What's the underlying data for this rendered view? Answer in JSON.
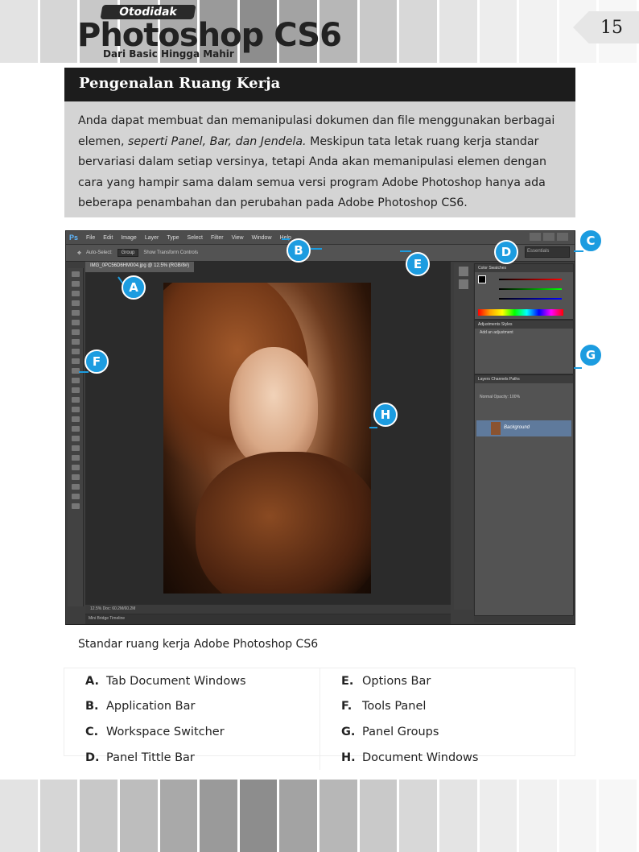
{
  "header": {
    "logo_small": "Otodidak",
    "logo_big": "Photoshop CS6",
    "logo_sub": "Dari Basic Hingga Mahir",
    "page_number": "15",
    "stripe_colors": [
      "#e3e3e3",
      "#d6d6d6",
      "#c8c8c8",
      "#bdbdbd",
      "#a9a9a9",
      "#9a9a9a",
      "#8d8d8d",
      "#a3a3a3",
      "#b7b7b7",
      "#c9c9c9",
      "#d8d8d8",
      "#e4e4e4",
      "#ededed",
      "#f2f2f2",
      "#f5f5f5",
      "#f7f7f7"
    ]
  },
  "section": {
    "title": "Pengenalan Ruang Kerja",
    "intro_before_italic": "Anda dapat membuat dan memanipulasi dokumen dan file menggunakan berbagai elemen, ",
    "intro_italic": "seperti Panel, Bar, dan Jendela.",
    "intro_after_italic": " Meskipun tata letak ruang kerja standar bervariasi dalam setiap versinya, tetapi Anda akan memanipulasi elemen dengan cara yang hampir sama dalam semua versi program Adobe Photoshop hanya ada beberapa penambahan dan perubahan pada Adobe Photoshop CS6."
  },
  "screenshot": {
    "menu": [
      "Ps",
      "File",
      "Edit",
      "Image",
      "Layer",
      "Type",
      "Select",
      "Filter",
      "View",
      "Window",
      "Help"
    ],
    "options": [
      "Auto-Select:",
      "Group",
      "Show Transform Controls"
    ],
    "workspace": "Essentials",
    "doc_tab": "IMG_0PC56D6HM004.jpg @ 12.5% (RGB/8#)",
    "status": "12.5%    Doc: 60.2M/60.2M",
    "mini_bridge": "Mini Bridge   Timeline",
    "color_tabs": "Color   Swatches",
    "adjust_tabs": "Adjustments   Styles",
    "adjust_label": "Add an adjustment",
    "layers_tabs": "Layers   Channels   Paths",
    "layers_mode": "Normal   Opacity: 100%",
    "layer_name": "Background",
    "accent": "#1c9ce0"
  },
  "callouts": [
    "A",
    "B",
    "C",
    "D",
    "E",
    "F",
    "G",
    "H"
  ],
  "caption": "Standar ruang kerja Adobe Photoshop CS6",
  "legend": [
    {
      "key": "A.",
      "label": "Tab Document Windows"
    },
    {
      "key": "E.",
      "label": "Options Bar"
    },
    {
      "key": "B.",
      "label": "Application Bar"
    },
    {
      "key": "F.",
      "label": "Tools Panel"
    },
    {
      "key": "C.",
      "label": "Workspace Switcher"
    },
    {
      "key": "G.",
      "label": "Panel Groups"
    },
    {
      "key": "D.",
      "label": "Panel Tittle Bar"
    },
    {
      "key": "H.",
      "label": "Document Windows"
    }
  ]
}
